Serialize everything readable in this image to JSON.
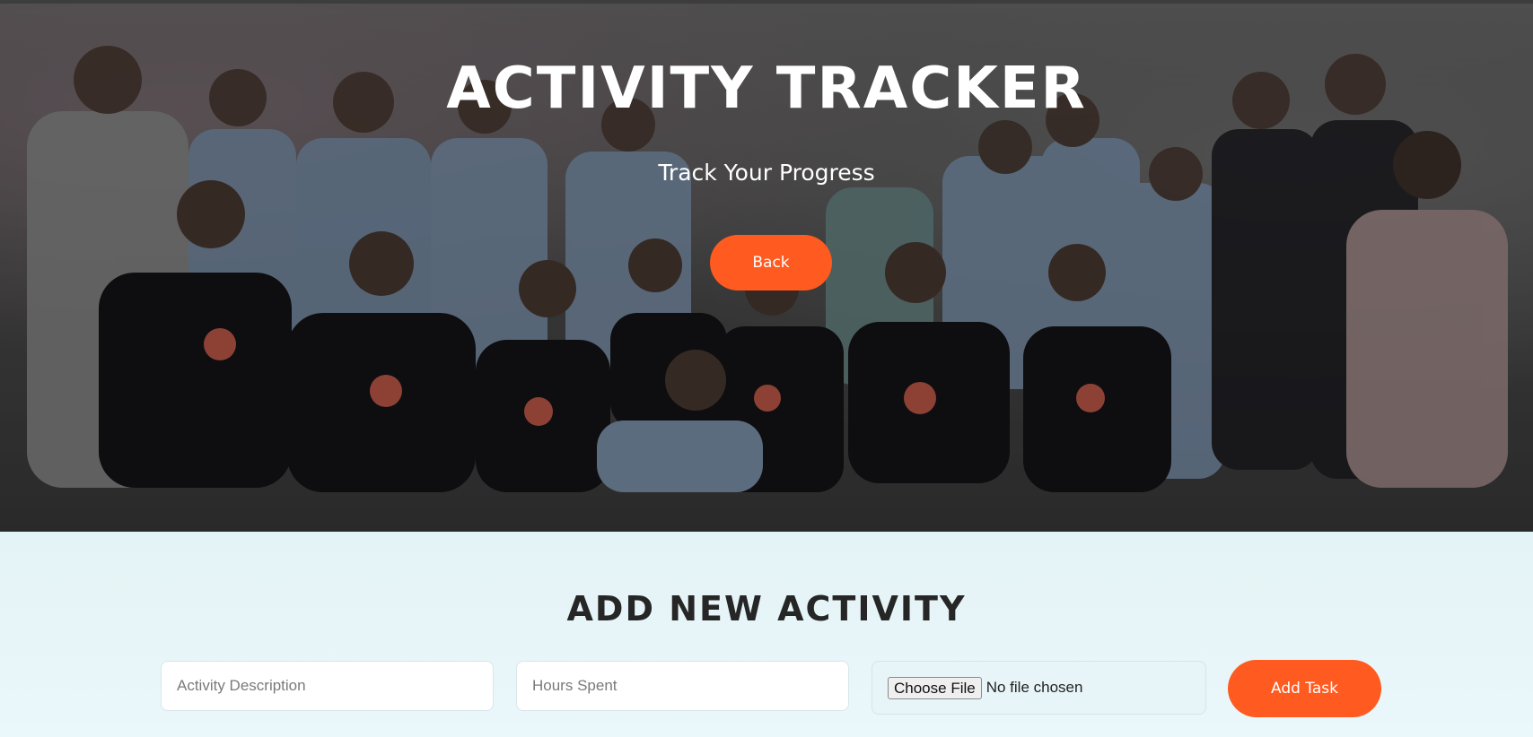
{
  "hero": {
    "title": "ACTIVITY TRACKER",
    "subtitle": "Track Your Progress",
    "back_label": "Back"
  },
  "form": {
    "title": "ADD NEW ACTIVITY",
    "description": {
      "placeholder": "Activity Description",
      "value": ""
    },
    "hours": {
      "placeholder": "Hours Spent",
      "value": ""
    },
    "file": {
      "button_label": "Choose File",
      "status": "No file chosen"
    },
    "submit_label": "Add Task"
  },
  "colors": {
    "accent": "#ff5a1f",
    "form_background": "#e6f4f7",
    "title_text": "#262626"
  }
}
